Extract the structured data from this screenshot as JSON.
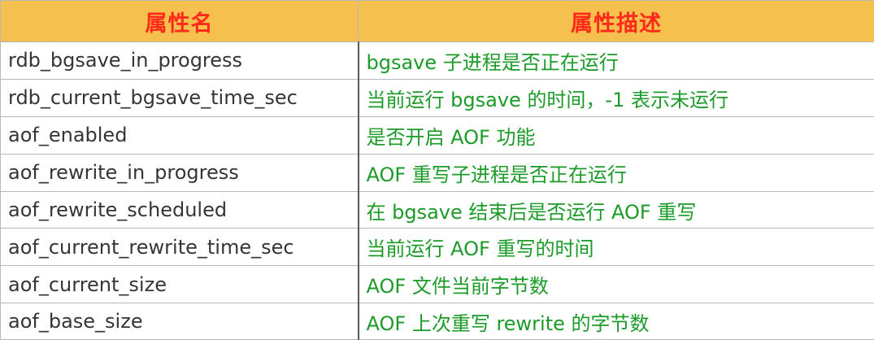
{
  "header": {
    "col_name": "属性名",
    "col_desc": "属性描述"
  },
  "rows": [
    {
      "name": "rdb_bgsave_in_progress",
      "desc": "bgsave 子进程是否正在运行"
    },
    {
      "name": "rdb_current_bgsave_time_sec",
      "desc": "当前运行 bgsave 的时间，-1 表示未运行"
    },
    {
      "name": "aof_enabled",
      "desc": "是否开启 AOF 功能"
    },
    {
      "name": "aof_rewrite_in_progress",
      "desc": "AOF 重写子进程是否正在运行"
    },
    {
      "name": "aof_rewrite_scheduled",
      "desc": "在 bgsave 结束后是否运行 AOF 重写"
    },
    {
      "name": "aof_current_rewrite_time_sec",
      "desc": "当前运行 AOF 重写的时间"
    },
    {
      "name": "aof_current_size",
      "desc": "AOF 文件当前字节数"
    },
    {
      "name": "aof_base_size",
      "desc": "AOF 上次重写 rewrite 的字节数"
    }
  ],
  "colors": {
    "header_bg": "#f6c04f",
    "header_text": "#ff2a1a",
    "name_text": "#353535",
    "desc_text": "#1c9b29"
  }
}
